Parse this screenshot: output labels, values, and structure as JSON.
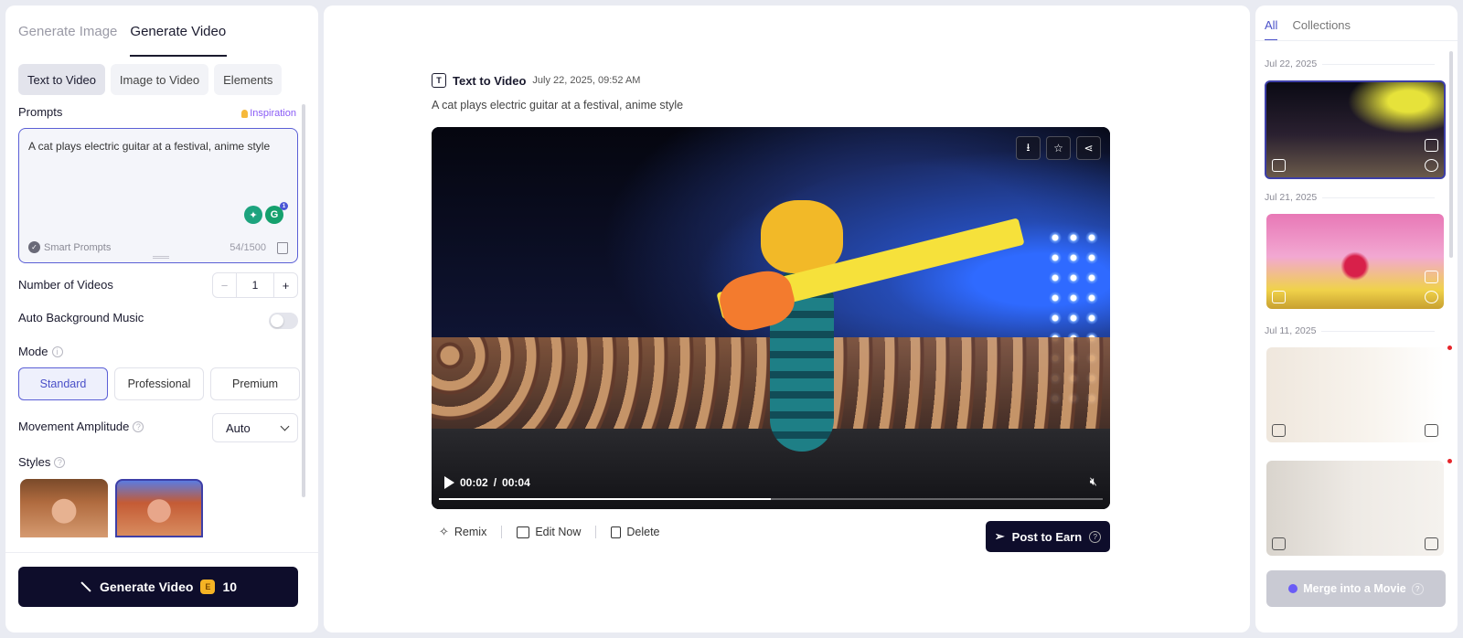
{
  "left": {
    "tabs": [
      "Generate Image",
      "Generate Video"
    ],
    "mode_tabs": [
      "Text to Video",
      "Image to Video",
      "Elements"
    ],
    "prompts_label": "Prompts",
    "inspiration": "Inspiration",
    "prompt_text": "A cat plays electric guitar at a festival, anime style",
    "smart_prompts": "Smart Prompts",
    "char_count": "54/1500",
    "num_videos_label": "Number of Videos",
    "num_videos_value": "1",
    "bg_music_label": "Auto Background Music",
    "bg_music_on": false,
    "mode_label": "Mode",
    "modes": [
      "Standard",
      "Professional",
      "Premium"
    ],
    "selected_mode": "Standard",
    "movement_label": "Movement Amplitude",
    "movement_value": "Auto",
    "styles_label": "Styles",
    "generate_label": "Generate Video",
    "generate_cost": "10"
  },
  "center": {
    "type_label": "Text to Video",
    "date": "July 22, 2025, 09:52 AM",
    "description": "A cat plays electric guitar at a festival, anime style",
    "current_time": "00:02",
    "duration": "00:04",
    "progress": 0.5,
    "actions": [
      "Remix",
      "Edit Now",
      "Delete"
    ],
    "post_label": "Post to Earn"
  },
  "right": {
    "tabs": [
      "All",
      "Collections"
    ],
    "dates": [
      "Jul 22, 2025",
      "Jul 21, 2025",
      "Jul 11, 2025"
    ],
    "merge_label": "Merge into a Movie"
  },
  "icons": {
    "download": "download-icon",
    "star": "star-icon",
    "share": "share-icon",
    "play": "play-icon",
    "mute": "mute-icon"
  },
  "colors": {
    "accent": "#5b5fd6",
    "primary_button": "#0e0d2b",
    "inspiration": "#8a5cf6"
  }
}
